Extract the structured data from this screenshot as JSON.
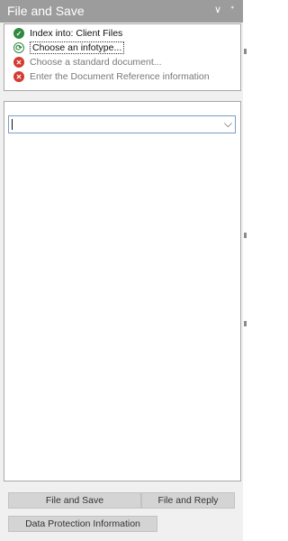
{
  "pane": {
    "title": "File and Save",
    "menu_glyph": "∨",
    "pin_glyph": "ᐩ"
  },
  "steps": [
    {
      "label": "Index into: Client Files",
      "status": "done",
      "icon": "check-icon",
      "glyph": "✓"
    },
    {
      "label": "Choose an infotype...",
      "status": "current",
      "icon": "pending-icon",
      "glyph": "⟳"
    },
    {
      "label": "Choose a standard document...",
      "status": "todo",
      "icon": "error-x-icon",
      "glyph": "✕"
    },
    {
      "label": "Enter the Document Reference information",
      "status": "todo",
      "icon": "error-x-icon",
      "glyph": "✕"
    }
  ],
  "infotype_select": {
    "value": "",
    "dropdown_glyph": "⌵"
  },
  "buttons": {
    "file_and_save": "File and Save",
    "file_and_reply": "File and Reply",
    "data_protection": "Data Protection Information"
  },
  "colors": {
    "titlebar": "#9c9c9c",
    "ok": "#2e8a3e",
    "error": "#d43a2f",
    "pane_bg": "#f0f0f0"
  }
}
